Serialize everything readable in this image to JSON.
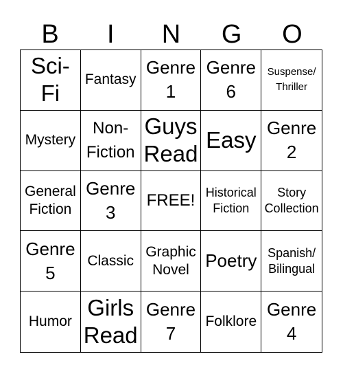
{
  "header": [
    "B",
    "I",
    "N",
    "G",
    "O"
  ],
  "cells": [
    "Sci-\nFi",
    "Fantasy",
    "Genre\n1",
    "Genre\n6",
    "Suspense/\nThriller",
    "Mystery",
    "Non-\nFiction",
    "Guys\nRead",
    "Easy",
    "Genre\n2",
    "General\nFiction",
    "Genre\n3",
    "FREE!",
    "Historical\nFiction",
    "Story\nCollection",
    "Genre\n5",
    "Classic",
    "Graphic\nNovel",
    "Poetry",
    "Spanish/\nBilingual",
    "Humor",
    "Girls\nRead",
    "Genre\n7",
    "Folklore",
    "Genre\n4"
  ]
}
